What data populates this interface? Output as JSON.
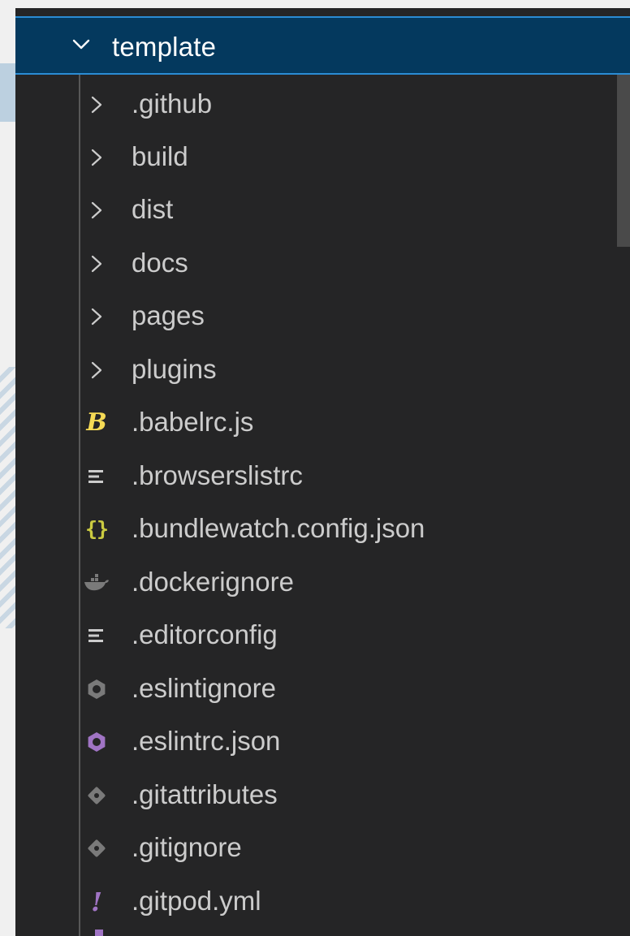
{
  "explorer": {
    "root": {
      "label": "template",
      "icon": "chevron-down-icon"
    },
    "items": [
      {
        "label": ".github",
        "kind": "folder",
        "icon": "chevron-right-icon"
      },
      {
        "label": "build",
        "kind": "folder",
        "icon": "chevron-right-icon"
      },
      {
        "label": "dist",
        "kind": "folder",
        "icon": "chevron-right-icon"
      },
      {
        "label": "docs",
        "kind": "folder",
        "icon": "chevron-right-icon"
      },
      {
        "label": "pages",
        "kind": "folder",
        "icon": "chevron-right-icon"
      },
      {
        "label": "plugins",
        "kind": "folder",
        "icon": "chevron-right-icon"
      },
      {
        "label": ".babelrc.js",
        "kind": "file",
        "icon": "babel-icon",
        "icon_color": "#f5da55"
      },
      {
        "label": ".browserslistrc",
        "kind": "file",
        "icon": "lines-icon",
        "icon_color": "#cccccc"
      },
      {
        "label": ".bundlewatch.config.json",
        "kind": "file",
        "icon": "json-braces-icon",
        "icon_color": "#cbcb41"
      },
      {
        "label": ".dockerignore",
        "kind": "file",
        "icon": "docker-icon",
        "icon_color": "#7a7a7a"
      },
      {
        "label": ".editorconfig",
        "kind": "file",
        "icon": "lines-icon",
        "icon_color": "#cccccc"
      },
      {
        "label": ".eslintignore",
        "kind": "file",
        "icon": "eslint-icon",
        "icon_color": "#7a7a7a"
      },
      {
        "label": ".eslintrc.json",
        "kind": "file",
        "icon": "eslint-icon",
        "icon_color": "#a074c4"
      },
      {
        "label": ".gitattributes",
        "kind": "file",
        "icon": "git-icon",
        "icon_color": "#7a7a7a"
      },
      {
        "label": ".gitignore",
        "kind": "file",
        "icon": "git-icon",
        "icon_color": "#7a7a7a"
      },
      {
        "label": ".gitpod.yml",
        "kind": "file",
        "icon": "yaml-icon",
        "icon_color": "#a074c4"
      }
    ]
  },
  "colors": {
    "panel_background": "#252526",
    "selection_background": "#04395e",
    "focus_border": "#2a8cd4",
    "text": "#cccccc"
  }
}
